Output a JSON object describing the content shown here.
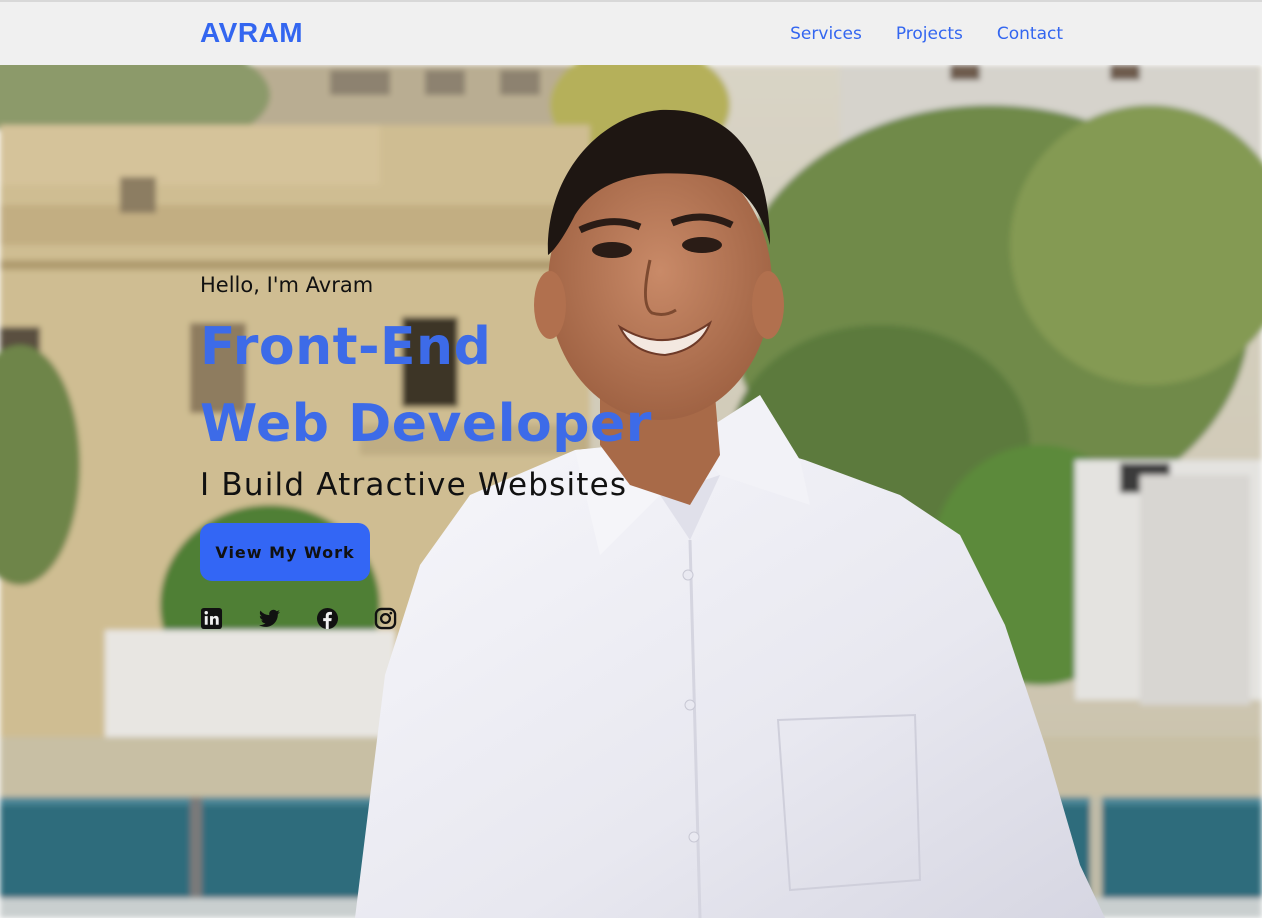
{
  "nav": {
    "logo": "AVRAM",
    "links": [
      {
        "label": "Services"
      },
      {
        "label": "Projects"
      },
      {
        "label": "Contact"
      }
    ]
  },
  "hero": {
    "greeting": "Hello, I'm Avram",
    "title_line1": "Front-End",
    "title_line2": "Web Developer",
    "tagline": "I Build Atractive Websites",
    "cta_label": "View My Work",
    "socials": [
      {
        "icon": "linkedin-icon"
      },
      {
        "icon": "twitter-icon"
      },
      {
        "icon": "facebook-icon"
      },
      {
        "icon": "instagram-icon"
      }
    ]
  },
  "colors": {
    "accent": "#3366f0",
    "nav_bg": "#f0f0f0",
    "text": "#111111"
  }
}
